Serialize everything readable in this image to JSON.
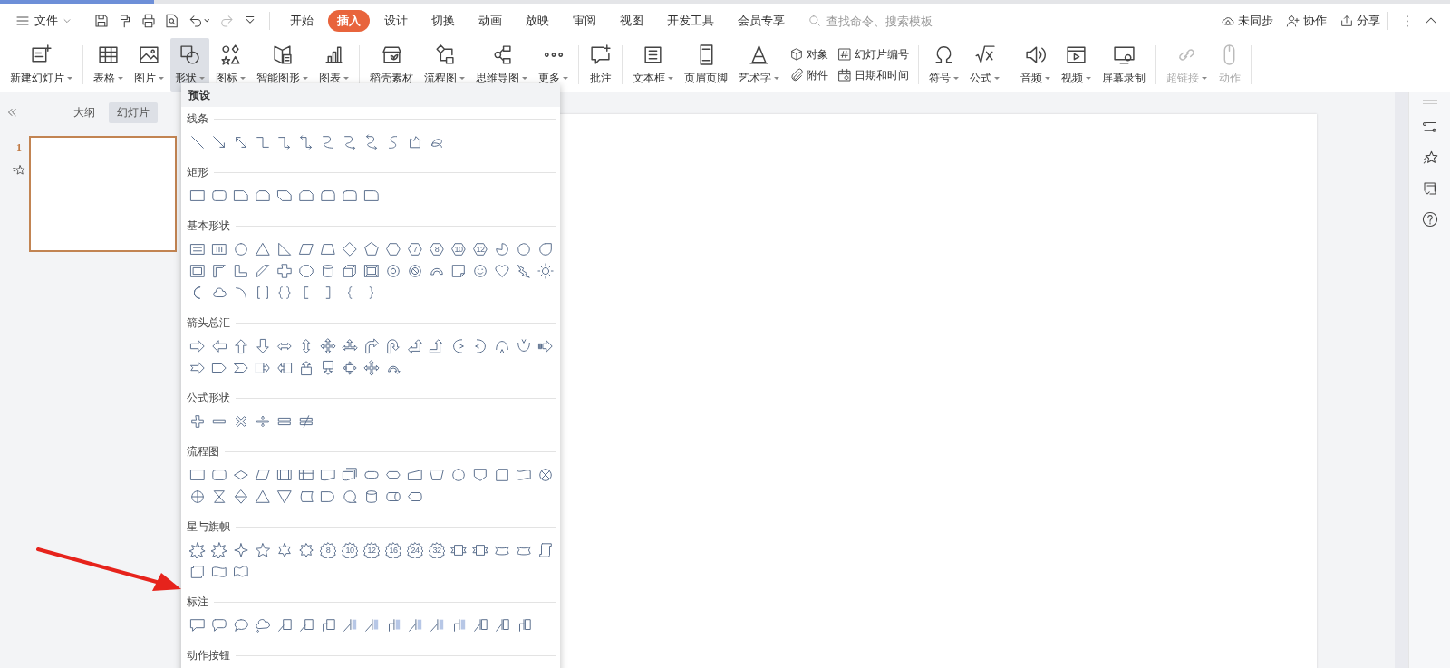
{
  "menu_bar": {
    "file_menu": "文件",
    "tabs": [
      {
        "label": "开始",
        "selected": false
      },
      {
        "label": "插入",
        "selected": true
      },
      {
        "label": "设计",
        "selected": false
      },
      {
        "label": "切换",
        "selected": false
      },
      {
        "label": "动画",
        "selected": false
      },
      {
        "label": "放映",
        "selected": false
      },
      {
        "label": "审阅",
        "selected": false
      },
      {
        "label": "视图",
        "selected": false
      },
      {
        "label": "开发工具",
        "selected": false
      },
      {
        "label": "会员专享",
        "selected": false
      }
    ],
    "search": {
      "placeholder": "查找命令、搜索模板"
    },
    "actions": [
      {
        "kind": "sync",
        "label": "未同步"
      },
      {
        "kind": "collaborate",
        "label": "协作"
      },
      {
        "kind": "share",
        "label": "分享"
      }
    ]
  },
  "ribbon": {
    "groups": [
      {
        "items": [
          {
            "kind": "new-slide",
            "label": "新建幻灯片",
            "dropdown": true,
            "selected": false,
            "disabled": false
          }
        ]
      },
      {
        "items": [
          {
            "kind": "table",
            "label": "表格",
            "dropdown": true,
            "selected": false,
            "disabled": false
          },
          {
            "kind": "picture",
            "label": "图片",
            "dropdown": true,
            "selected": false,
            "disabled": false
          },
          {
            "kind": "shape",
            "label": "形状",
            "dropdown": true,
            "selected": true,
            "disabled": false
          },
          {
            "kind": "icons",
            "label": "图标",
            "dropdown": true,
            "selected": false,
            "disabled": false
          },
          {
            "kind": "smart-art",
            "label": "智能图形",
            "dropdown": true,
            "selected": false,
            "disabled": false
          },
          {
            "kind": "chart",
            "label": "图表",
            "dropdown": true,
            "selected": false,
            "disabled": false
          }
        ]
      },
      {
        "items": [
          {
            "kind": "material",
            "label": "稻壳素材",
            "dropdown": false,
            "selected": false,
            "disabled": false
          },
          {
            "kind": "flowchart",
            "label": "流程图",
            "dropdown": true,
            "selected": false,
            "disabled": false
          },
          {
            "kind": "mindmap",
            "label": "思维导图",
            "dropdown": true,
            "selected": false,
            "disabled": false
          },
          {
            "kind": "more",
            "label": "更多",
            "dropdown": true,
            "selected": false,
            "disabled": false
          }
        ]
      },
      {
        "items": [
          {
            "kind": "comment",
            "label": "批注",
            "dropdown": false,
            "selected": false,
            "disabled": false
          }
        ]
      },
      {
        "items": [
          {
            "kind": "textbox",
            "label": "文本框",
            "dropdown": true,
            "selected": false,
            "disabled": false
          },
          {
            "kind": "header-footer",
            "label": "页眉页脚",
            "dropdown": false,
            "selected": false,
            "disabled": false
          },
          {
            "kind": "wordart",
            "label": "艺术字",
            "dropdown": true,
            "selected": false,
            "disabled": false
          },
          {
            "stack": [
              {
                "kind": "object",
                "label": "对象"
              },
              {
                "kind": "attachment",
                "label": "附件"
              }
            ]
          },
          {
            "stack": [
              {
                "kind": "slide-number",
                "label": "幻灯片编号"
              },
              {
                "kind": "date-time",
                "label": "日期和时间"
              }
            ]
          }
        ]
      },
      {
        "items": [
          {
            "kind": "symbol",
            "label": "符号",
            "dropdown": true,
            "selected": false,
            "disabled": false
          },
          {
            "kind": "formula",
            "label": "公式",
            "dropdown": true,
            "selected": false,
            "disabled": false
          }
        ]
      },
      {
        "items": [
          {
            "kind": "audio",
            "label": "音频",
            "dropdown": true,
            "selected": false,
            "disabled": false
          },
          {
            "kind": "video",
            "label": "视频",
            "dropdown": true,
            "selected": false,
            "disabled": false
          },
          {
            "kind": "screen-record",
            "label": "屏幕录制",
            "dropdown": false,
            "selected": false,
            "disabled": false
          }
        ]
      },
      {
        "items": [
          {
            "kind": "hyperlink",
            "label": "超链接",
            "dropdown": true,
            "selected": false,
            "disabled": true
          },
          {
            "kind": "action",
            "label": "动作",
            "dropdown": false,
            "selected": false,
            "disabled": true
          }
        ]
      }
    ]
  },
  "slide_panel": {
    "tabs": [
      {
        "label": "大纲",
        "selected": false
      },
      {
        "label": "幻灯片",
        "selected": true
      }
    ],
    "slides": [
      {
        "number": "1",
        "selected": true
      }
    ]
  },
  "shape_menu": {
    "header": "预设",
    "sections": [
      {
        "title": "线条",
        "shapes": [
          {
            "kind": "line"
          },
          {
            "kind": "arrow-line"
          },
          {
            "kind": "double-arrow-line"
          },
          {
            "kind": "elbow"
          },
          {
            "kind": "elbow-arrow"
          },
          {
            "kind": "elbow-double-arrow"
          },
          {
            "kind": "curve"
          },
          {
            "kind": "curve-arrow"
          },
          {
            "kind": "curve-double-arrow"
          },
          {
            "kind": "s-curve"
          },
          {
            "kind": "freeform"
          },
          {
            "kind": "scribble"
          }
        ]
      },
      {
        "title": "矩形",
        "shapes": [
          {
            "kind": "rectangle"
          },
          {
            "kind": "round-rectangle"
          },
          {
            "kind": "snip-rectangle"
          },
          {
            "kind": "snip-same-rectangle"
          },
          {
            "kind": "snip-diagonal-rectangle"
          },
          {
            "kind": "snip-same-rectangle"
          },
          {
            "kind": "round-same-rectangle"
          },
          {
            "kind": "round-same-rectangle"
          },
          {
            "kind": "round-one-rectangle"
          }
        ]
      },
      {
        "title": "基本形状",
        "shapes": [
          {
            "kind": "text-box"
          },
          {
            "kind": "vertical-text-box"
          },
          {
            "kind": "circle"
          },
          {
            "kind": "triangle"
          },
          {
            "kind": "right-triangle"
          },
          {
            "kind": "parallelogram"
          },
          {
            "kind": "trapezoid"
          },
          {
            "kind": "diamond"
          },
          {
            "kind": "pentagon"
          },
          {
            "kind": "hexagon"
          },
          {
            "kind": "numbered-polygon",
            "label": "7"
          },
          {
            "kind": "numbered-polygon",
            "label": "8"
          },
          {
            "kind": "numbered-polygon",
            "label": "10"
          },
          {
            "kind": "numbered-polygon",
            "label": "12"
          },
          {
            "kind": "pie"
          },
          {
            "kind": "chord"
          },
          {
            "kind": "teardrop"
          },
          {
            "kind": "frame"
          },
          {
            "kind": "half-frame"
          },
          {
            "kind": "l-shape"
          },
          {
            "kind": "diagonal-stripe"
          },
          {
            "kind": "cross"
          },
          {
            "kind": "octagon"
          },
          {
            "kind": "cylinder"
          },
          {
            "kind": "cube"
          },
          {
            "kind": "bevel"
          },
          {
            "kind": "donut"
          },
          {
            "kind": "no-symbol"
          },
          {
            "kind": "block-arc"
          },
          {
            "kind": "folded-corner"
          },
          {
            "kind": "smiley"
          },
          {
            "kind": "heart"
          },
          {
            "kind": "lightning"
          },
          {
            "kind": "sun"
          },
          {
            "kind": "moon"
          },
          {
            "kind": "cloud"
          },
          {
            "kind": "arc"
          },
          {
            "kind": "double-bracket"
          },
          {
            "kind": "double-brace"
          },
          {
            "kind": "left-bracket"
          },
          {
            "kind": "right-bracket"
          },
          {
            "kind": "left-brace"
          },
          {
            "kind": "right-brace"
          }
        ]
      },
      {
        "title": "箭头总汇",
        "shapes": [
          {
            "kind": "arrow-right"
          },
          {
            "kind": "arrow-left"
          },
          {
            "kind": "arrow-up"
          },
          {
            "kind": "arrow-down"
          },
          {
            "kind": "arrow-left-right"
          },
          {
            "kind": "arrow-up-down"
          },
          {
            "kind": "quad-arrow"
          },
          {
            "kind": "tri-arrow"
          },
          {
            "kind": "bent-arrow"
          },
          {
            "kind": "u-turn-arrow"
          },
          {
            "kind": "left-up-arrow"
          },
          {
            "kind": "bent-up-arrow"
          },
          {
            "kind": "curved-arrow-right"
          },
          {
            "kind": "curved-arrow-left"
          },
          {
            "kind": "curved-arrow-up"
          },
          {
            "kind": "curved-arrow-down"
          },
          {
            "kind": "striped-arrow"
          },
          {
            "kind": "notched-arrow"
          },
          {
            "kind": "pentagon-arrow"
          },
          {
            "kind": "chevron"
          },
          {
            "kind": "callout-arrow-right"
          },
          {
            "kind": "callout-arrow-left"
          },
          {
            "kind": "callout-arrow-up"
          },
          {
            "kind": "callout-arrow-down"
          },
          {
            "kind": "callout-arrow-quad"
          },
          {
            "kind": "quad-arrow"
          },
          {
            "kind": "circular-arrow"
          }
        ]
      },
      {
        "title": "公式形状",
        "shapes": [
          {
            "kind": "plus"
          },
          {
            "kind": "minus"
          },
          {
            "kind": "multiply"
          },
          {
            "kind": "divide"
          },
          {
            "kind": "equal"
          },
          {
            "kind": "not-equal"
          }
        ]
      },
      {
        "title": "流程图",
        "shapes": [
          {
            "kind": "process"
          },
          {
            "kind": "alternate-process"
          },
          {
            "kind": "decision"
          },
          {
            "kind": "data"
          },
          {
            "kind": "predefined-process"
          },
          {
            "kind": "internal-storage"
          },
          {
            "kind": "document"
          },
          {
            "kind": "multidocument"
          },
          {
            "kind": "terminator"
          },
          {
            "kind": "preparation"
          },
          {
            "kind": "manual-input"
          },
          {
            "kind": "manual-operation"
          },
          {
            "kind": "connector"
          },
          {
            "kind": "off-page-connector"
          },
          {
            "kind": "card"
          },
          {
            "kind": "punched-tape"
          },
          {
            "kind": "summing-junction"
          },
          {
            "kind": "or"
          },
          {
            "kind": "collate"
          },
          {
            "kind": "sort"
          },
          {
            "kind": "extract"
          },
          {
            "kind": "merge"
          },
          {
            "kind": "stored-data"
          },
          {
            "kind": "delay"
          },
          {
            "kind": "sequential-access"
          },
          {
            "kind": "magnetic-disk"
          },
          {
            "kind": "direct-access"
          },
          {
            "kind": "display"
          }
        ]
      },
      {
        "title": "星与旗帜",
        "shapes": [
          {
            "kind": "explosion"
          },
          {
            "kind": "explosion"
          },
          {
            "kind": "four-point-star"
          },
          {
            "kind": "five-point-star"
          },
          {
            "kind": "six-point-star"
          },
          {
            "kind": "seven-point-star"
          },
          {
            "kind": "numbered-seal",
            "label": "8"
          },
          {
            "kind": "numbered-seal",
            "label": "10"
          },
          {
            "kind": "numbered-seal",
            "label": "12"
          },
          {
            "kind": "numbered-seal",
            "label": "16"
          },
          {
            "kind": "numbered-seal",
            "label": "24"
          },
          {
            "kind": "numbered-seal",
            "label": "32"
          },
          {
            "kind": "ribbon"
          },
          {
            "kind": "ribbon"
          },
          {
            "kind": "curved-ribbon"
          },
          {
            "kind": "curved-ribbon"
          },
          {
            "kind": "vertical-scroll"
          },
          {
            "kind": "horizontal-scroll"
          },
          {
            "kind": "wave"
          },
          {
            "kind": "double-wave"
          }
        ]
      },
      {
        "title": "标注",
        "shapes": [
          {
            "kind": "rectangle-callout"
          },
          {
            "kind": "round-callout"
          },
          {
            "kind": "oval-callout"
          },
          {
            "kind": "cloud-callout"
          },
          {
            "kind": "line-callout"
          },
          {
            "kind": "line-callout"
          },
          {
            "kind": "bent-line-callout"
          },
          {
            "kind": "accent-callout"
          },
          {
            "kind": "accent-callout"
          },
          {
            "kind": "bent-accent-callout"
          },
          {
            "kind": "accent-callout"
          },
          {
            "kind": "accent-callout"
          },
          {
            "kind": "bent-accent-callout"
          },
          {
            "kind": "border-callout"
          },
          {
            "kind": "border-callout"
          },
          {
            "kind": "bent-border-callout"
          }
        ]
      },
      {
        "title": "动作按钮"
      }
    ]
  }
}
